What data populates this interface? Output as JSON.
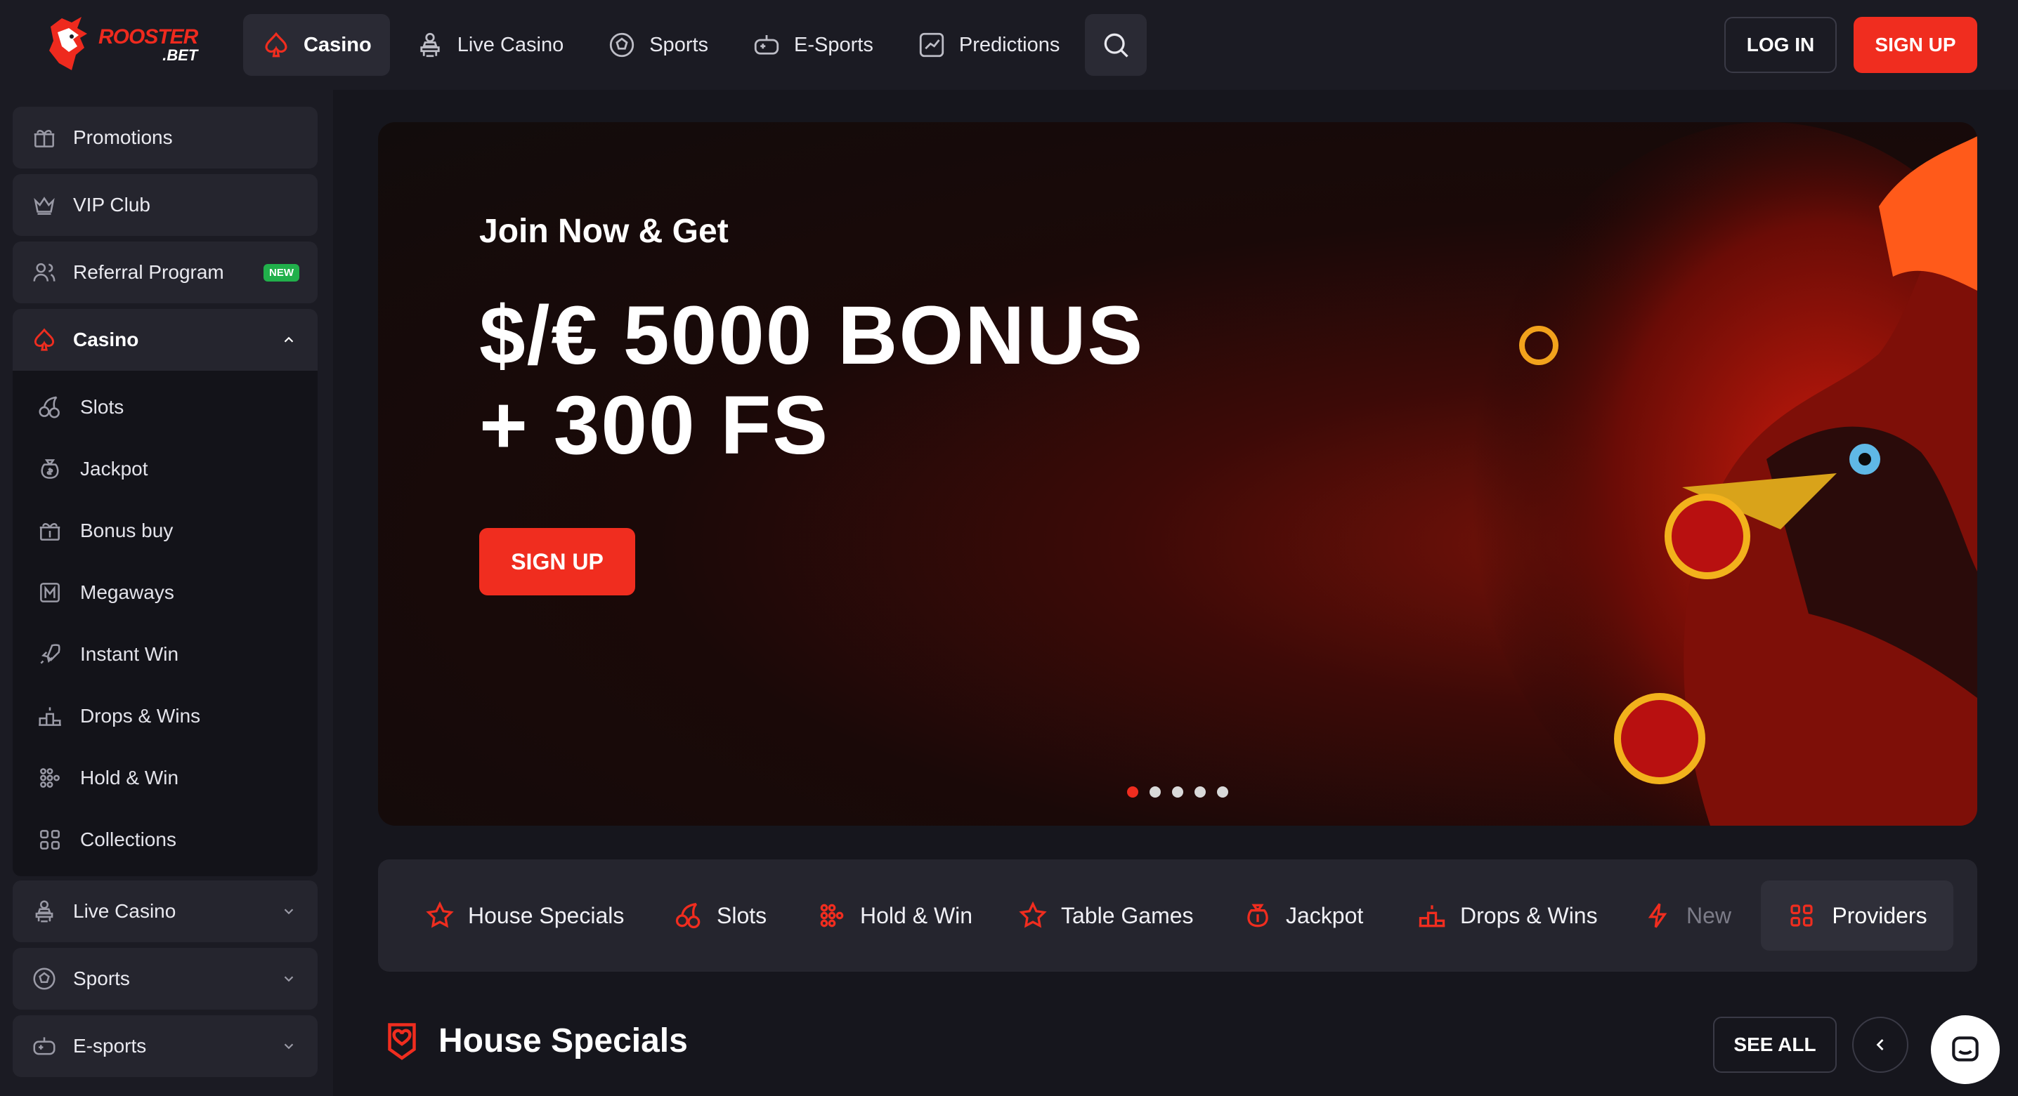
{
  "brand": {
    "logo_line1": "ROOSTER",
    "logo_line2": ".BET",
    "accent": "#f02d1f",
    "new_badge_color": "#21b04b"
  },
  "header": {
    "nav": [
      {
        "label": "Casino",
        "icon": "spade-icon",
        "active": true
      },
      {
        "label": "Live Casino",
        "icon": "dealer-icon"
      },
      {
        "label": "Sports",
        "icon": "soccer-ball-icon"
      },
      {
        "label": "E-Sports",
        "icon": "gamepad-icon"
      },
      {
        "label": "Predictions",
        "icon": "chart-trend-icon"
      }
    ],
    "search_icon": "search-icon",
    "login_label": "LOG IN",
    "signup_label": "SIGN UP"
  },
  "sidebar": {
    "top_items": [
      {
        "label": "Promotions",
        "icon": "gift-icon"
      },
      {
        "label": "VIP Club",
        "icon": "crown-icon"
      },
      {
        "label": "Referral Program",
        "icon": "users-icon",
        "badge": "NEW"
      }
    ],
    "casino": {
      "label": "Casino",
      "icon": "spade-icon",
      "expanded": true
    },
    "casino_sub": [
      {
        "label": "Slots",
        "icon": "cherries-icon"
      },
      {
        "label": "Jackpot",
        "icon": "money-bag-icon"
      },
      {
        "label": "Bonus buy",
        "icon": "gift-dollar-icon"
      },
      {
        "label": "Megaways",
        "icon": "megaways-icon"
      },
      {
        "label": "Instant Win",
        "icon": "rocket-icon"
      },
      {
        "label": "Drops & Wins",
        "icon": "podium-icon"
      },
      {
        "label": "Hold & Win",
        "icon": "dots-grid-icon"
      },
      {
        "label": "Collections",
        "icon": "grid-icon"
      }
    ],
    "bottom_items": [
      {
        "label": "Live Casino",
        "icon": "dealer-icon"
      },
      {
        "label": "Sports",
        "icon": "soccer-ball-icon"
      },
      {
        "label": "E-sports",
        "icon": "gamepad-icon"
      }
    ]
  },
  "hero": {
    "subtitle": "Join Now & Get",
    "title_line1": "$/€ 5000 BONUS",
    "title_line2": "+ 300 FS",
    "button_label": "SIGN UP",
    "slides_total": 5,
    "active_slide": 1
  },
  "categories": [
    {
      "label": "House Specials",
      "icon": "star-icon"
    },
    {
      "label": "Slots",
      "icon": "cherries-icon"
    },
    {
      "label": "Hold & Win",
      "icon": "dots-grid-icon"
    },
    {
      "label": "Table Games",
      "icon": "star-icon"
    },
    {
      "label": "Jackpot",
      "icon": "money-bag-icon"
    },
    {
      "label": "Drops & Wins",
      "icon": "podium-icon"
    },
    {
      "label": "New",
      "icon": "lightning-icon"
    },
    {
      "label": "Providers",
      "icon": "grid-icon"
    }
  ],
  "section": {
    "title": "House Specials",
    "icon": "heart-badge-icon",
    "see_all_label": "SEE ALL"
  }
}
